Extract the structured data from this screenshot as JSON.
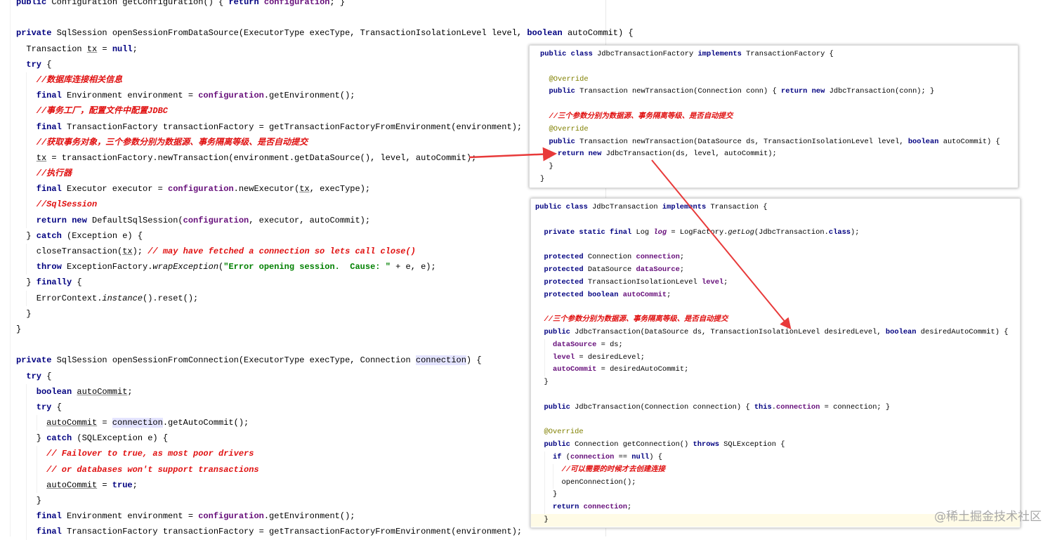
{
  "colors": {
    "keyword": "#000080",
    "comment": "#e01010",
    "field": "#660e7a",
    "string": "#008000",
    "annotation": "#808000",
    "arrow": "#e83a3a"
  },
  "editor": {
    "lines": [
      [
        0,
        [
          [
            "k",
            "public "
          ],
          [
            "p",
            "Configuration getConfiguration() { "
          ],
          [
            "k",
            "return "
          ],
          [
            "f",
            "configuration"
          ],
          [
            "p",
            "; }"
          ]
        ]
      ],
      [
        0,
        []
      ],
      [
        0,
        [
          [
            "k",
            "private "
          ],
          [
            "p",
            "SqlSession openSessionFromDataSource(ExecutorType execType, TransactionIsolationLevel level, "
          ],
          [
            "k",
            "boolean "
          ],
          [
            "p",
            "autoCommit) {"
          ]
        ]
      ],
      [
        1,
        [
          [
            "p",
            "Transaction "
          ],
          [
            "u",
            "tx"
          ],
          [
            "p",
            " = "
          ],
          [
            "k",
            "null"
          ],
          [
            "p",
            ";"
          ]
        ]
      ],
      [
        1,
        [
          [
            "k",
            "try "
          ],
          [
            "p",
            "{"
          ]
        ]
      ],
      [
        2,
        [
          [
            "c",
            "//数据库连接相关信息"
          ]
        ]
      ],
      [
        2,
        [
          [
            "k",
            "final "
          ],
          [
            "p",
            "Environment environment = "
          ],
          [
            "f",
            "configuration"
          ],
          [
            "p",
            ".getEnvironment();"
          ]
        ]
      ],
      [
        2,
        [
          [
            "c",
            "//事务工厂，配置文件中配置JDBC"
          ]
        ]
      ],
      [
        2,
        [
          [
            "k",
            "final "
          ],
          [
            "p",
            "TransactionFactory transactionFactory = getTransactionFactoryFromEnvironment(environment);"
          ]
        ]
      ],
      [
        2,
        [
          [
            "c",
            "//获取事务对象，三个参数分别为数据源、事务隔离等级、是否自动提交"
          ]
        ]
      ],
      [
        2,
        [
          [
            "u",
            "tx"
          ],
          [
            "p",
            " = transactionFactory.newTransaction(environment.getDataSource(), level, autoCommit);"
          ]
        ]
      ],
      [
        2,
        [
          [
            "c",
            "//执行器"
          ]
        ]
      ],
      [
        2,
        [
          [
            "k",
            "final "
          ],
          [
            "p",
            "Executor executor = "
          ],
          [
            "f",
            "configuration"
          ],
          [
            "p",
            ".newExecutor("
          ],
          [
            "u",
            "tx"
          ],
          [
            "p",
            ", execType);"
          ]
        ]
      ],
      [
        2,
        [
          [
            "c",
            "//SqlSession"
          ]
        ]
      ],
      [
        2,
        [
          [
            "k",
            "return new "
          ],
          [
            "p",
            "DefaultSqlSession("
          ],
          [
            "f",
            "configuration"
          ],
          [
            "p",
            ", executor, autoCommit);"
          ]
        ]
      ],
      [
        1,
        [
          [
            "p",
            "} "
          ],
          [
            "k",
            "catch "
          ],
          [
            "p",
            "(Exception e) {"
          ]
        ]
      ],
      [
        2,
        [
          [
            "p",
            "closeTransaction("
          ],
          [
            "u",
            "tx"
          ],
          [
            "p",
            "); "
          ],
          [
            "c",
            "// may have fetched a connection so lets call close()"
          ]
        ]
      ],
      [
        2,
        [
          [
            "k",
            "throw "
          ],
          [
            "p",
            "ExceptionFactory."
          ],
          [
            "i",
            "wrapException"
          ],
          [
            "p",
            "("
          ],
          [
            "s",
            "\"Error opening session.  Cause: \""
          ],
          [
            "p",
            " + e, e);"
          ]
        ]
      ],
      [
        1,
        [
          [
            "p",
            "} "
          ],
          [
            "k",
            "finally "
          ],
          [
            "p",
            "{"
          ]
        ]
      ],
      [
        2,
        [
          [
            "p",
            "ErrorContext."
          ],
          [
            "i",
            "instance"
          ],
          [
            "p",
            "().reset();"
          ]
        ]
      ],
      [
        1,
        [
          [
            "p",
            "}"
          ]
        ]
      ],
      [
        0,
        [
          [
            "p",
            "}"
          ]
        ]
      ],
      [
        0,
        []
      ],
      [
        0,
        [
          [
            "k",
            "private "
          ],
          [
            "p",
            "SqlSession openSessionFromConnection(ExecutorType execType, Connection "
          ],
          [
            "h",
            "connection"
          ],
          [
            "p",
            ") {"
          ]
        ]
      ],
      [
        1,
        [
          [
            "k",
            "try "
          ],
          [
            "p",
            "{"
          ]
        ]
      ],
      [
        2,
        [
          [
            "k",
            "boolean "
          ],
          [
            "u",
            "autoCommit"
          ],
          [
            "p",
            ";"
          ]
        ]
      ],
      [
        2,
        [
          [
            "k",
            "try "
          ],
          [
            "p",
            "{"
          ]
        ]
      ],
      [
        3,
        [
          [
            "u",
            "autoCommit"
          ],
          [
            "p",
            " = "
          ],
          [
            "h",
            "connection"
          ],
          [
            "p",
            ".getAutoCommit();"
          ]
        ]
      ],
      [
        2,
        [
          [
            "p",
            "} "
          ],
          [
            "k",
            "catch "
          ],
          [
            "p",
            "(SQLException e) {"
          ]
        ]
      ],
      [
        3,
        [
          [
            "c",
            "// Failover to true, as most poor drivers"
          ]
        ]
      ],
      [
        3,
        [
          [
            "c",
            "// or databases won't support transactions"
          ]
        ]
      ],
      [
        3,
        [
          [
            "u",
            "autoCommit"
          ],
          [
            "p",
            " = "
          ],
          [
            "k",
            "true"
          ],
          [
            "p",
            ";"
          ]
        ]
      ],
      [
        2,
        [
          [
            "p",
            "}"
          ]
        ]
      ],
      [
        2,
        [
          [
            "k",
            "final "
          ],
          [
            "p",
            "Environment environment = "
          ],
          [
            "f",
            "configuration"
          ],
          [
            "p",
            ".getEnvironment();"
          ]
        ]
      ],
      [
        2,
        [
          [
            "k",
            "final "
          ],
          [
            "p",
            "TransactionFactory transactionFactory = getTransactionFactoryFromEnvironment(environment);"
          ]
        ]
      ]
    ]
  },
  "popup1": {
    "lines": [
      [
        0,
        [
          [
            "k",
            "public class "
          ],
          [
            "p",
            "JdbcTransactionFactory "
          ],
          [
            "k",
            "implements "
          ],
          [
            "p",
            "TransactionFactory {"
          ]
        ]
      ],
      [
        0,
        []
      ],
      [
        1,
        [
          [
            "a",
            "@Override"
          ]
        ]
      ],
      [
        1,
        [
          [
            "k",
            "public "
          ],
          [
            "p",
            "Transaction newTransaction(Connection conn) { "
          ],
          [
            "k",
            "return new "
          ],
          [
            "p",
            "JdbcTransaction(conn); }"
          ]
        ]
      ],
      [
        0,
        []
      ],
      [
        1,
        [
          [
            "c",
            "//三个参数分别为数据源、事务隔离等级、是否自动提交"
          ]
        ]
      ],
      [
        1,
        [
          [
            "a",
            "@Override"
          ]
        ]
      ],
      [
        1,
        [
          [
            "k",
            "public "
          ],
          [
            "p",
            "Transaction newTransaction(DataSource ds, TransactionIsolationLevel level, "
          ],
          [
            "k",
            "boolean "
          ],
          [
            "p",
            "autoCommit) {"
          ]
        ]
      ],
      [
        2,
        [
          [
            "k",
            "return new "
          ],
          [
            "p",
            "JdbcTransaction(ds, level, autoCommit);"
          ]
        ]
      ],
      [
        1,
        [
          [
            "p",
            "}"
          ]
        ]
      ],
      [
        0,
        [
          [
            "p",
            "}"
          ]
        ]
      ]
    ]
  },
  "popup2": {
    "lines": [
      [
        0,
        [
          [
            "k",
            "public class "
          ],
          [
            "p",
            "JdbcTransaction "
          ],
          [
            "k",
            "implements "
          ],
          [
            "p",
            "Transaction {"
          ]
        ]
      ],
      [
        0,
        []
      ],
      [
        1,
        [
          [
            "k",
            "private static final "
          ],
          [
            "p",
            "Log "
          ],
          [
            "fi",
            "log"
          ],
          [
            "p",
            " = LogFactory."
          ],
          [
            "i",
            "getLog"
          ],
          [
            "p",
            "(JdbcTransaction."
          ],
          [
            "k",
            "class"
          ],
          [
            "p",
            ");"
          ]
        ]
      ],
      [
        0,
        []
      ],
      [
        1,
        [
          [
            "k",
            "protected "
          ],
          [
            "p",
            "Connection "
          ],
          [
            "f",
            "connection"
          ],
          [
            "p",
            ";"
          ]
        ]
      ],
      [
        1,
        [
          [
            "k",
            "protected "
          ],
          [
            "p",
            "DataSource "
          ],
          [
            "f",
            "dataSource"
          ],
          [
            "p",
            ";"
          ]
        ]
      ],
      [
        1,
        [
          [
            "k",
            "protected "
          ],
          [
            "p",
            "TransactionIsolationLevel "
          ],
          [
            "f",
            "level"
          ],
          [
            "p",
            ";"
          ]
        ]
      ],
      [
        1,
        [
          [
            "k",
            "protected boolean "
          ],
          [
            "f",
            "autoCommit"
          ],
          [
            "p",
            ";"
          ]
        ]
      ],
      [
        0,
        []
      ],
      [
        1,
        [
          [
            "c",
            "//三个参数分别为数据源、事务隔离等级、是否自动提交"
          ]
        ]
      ],
      [
        1,
        [
          [
            "k",
            "public "
          ],
          [
            "p",
            "JdbcTransaction(DataSource ds, TransactionIsolationLevel desiredLevel, "
          ],
          [
            "k",
            "boolean "
          ],
          [
            "p",
            "desiredAutoCommit) {"
          ]
        ]
      ],
      [
        2,
        [
          [
            "f",
            "dataSource"
          ],
          [
            "p",
            " = ds;"
          ]
        ]
      ],
      [
        2,
        [
          [
            "f",
            "level"
          ],
          [
            "p",
            " = desiredLevel;"
          ]
        ]
      ],
      [
        2,
        [
          [
            "f",
            "autoCommit"
          ],
          [
            "p",
            " = desiredAutoCommit;"
          ]
        ]
      ],
      [
        1,
        [
          [
            "p",
            "}"
          ]
        ]
      ],
      [
        0,
        []
      ],
      [
        1,
        [
          [
            "k",
            "public "
          ],
          [
            "p",
            "JdbcTransaction(Connection connection) { "
          ],
          [
            "k",
            "this"
          ],
          [
            "p",
            "."
          ],
          [
            "f",
            "connection"
          ],
          [
            "p",
            " = connection; }"
          ]
        ]
      ],
      [
        0,
        []
      ],
      [
        1,
        [
          [
            "a",
            "@Override"
          ]
        ]
      ],
      [
        1,
        [
          [
            "k",
            "public "
          ],
          [
            "p",
            "Connection getConnection() "
          ],
          [
            "k",
            "throws "
          ],
          [
            "p",
            "SQLException {"
          ]
        ]
      ],
      [
        2,
        [
          [
            "k",
            "if "
          ],
          [
            "p",
            "("
          ],
          [
            "f",
            "connection"
          ],
          [
            "p",
            " == "
          ],
          [
            "k",
            "null"
          ],
          [
            "p",
            ") {"
          ]
        ]
      ],
      [
        3,
        [
          [
            "c",
            "//可以需要的时候才去创建连接"
          ]
        ]
      ],
      [
        3,
        [
          [
            "p",
            "openConnection();"
          ]
        ]
      ],
      [
        2,
        [
          [
            "p",
            "}"
          ]
        ]
      ],
      [
        2,
        [
          [
            "k",
            "return "
          ],
          [
            "f",
            "connection"
          ],
          [
            "p",
            ";"
          ]
        ]
      ],
      [
        1,
        [
          [
            "p",
            "}"
          ]
        ]
      ]
    ]
  },
  "watermark": "@稀土掘金技术社区"
}
